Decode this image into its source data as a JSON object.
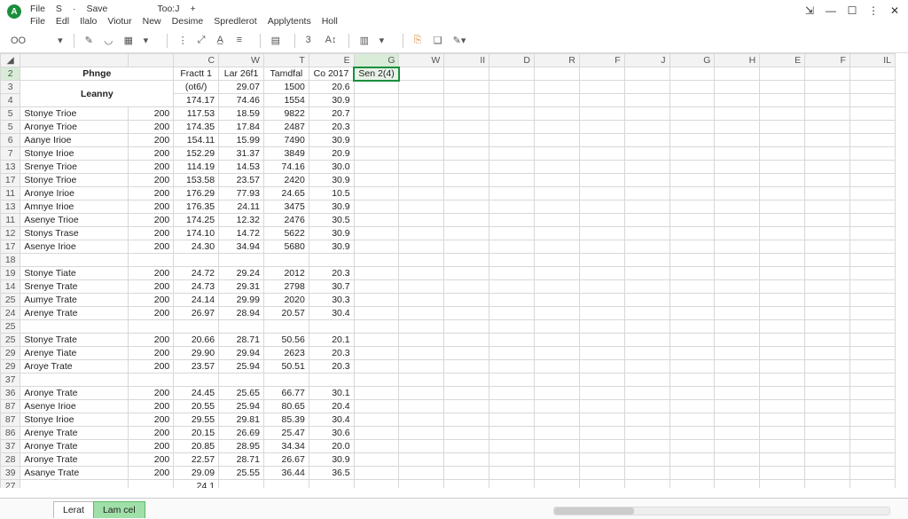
{
  "titlebar": {
    "quick1": "File",
    "quick2": "S",
    "dot": "·",
    "save": "Save",
    "tooj": "Too:J",
    "plus": "+",
    "menu": [
      "File",
      "Edl",
      "Ilalo",
      "Viotur",
      "New",
      "Desime",
      "Spredlerot",
      "Applytents",
      "Holl"
    ]
  },
  "window": {
    "restore_glyph": "⇲",
    "min": "—",
    "max": "☐",
    "close": "✕",
    "menu": "⋮"
  },
  "toolbar": {
    "mode": "OO",
    "chev": "▾",
    "icons": [
      "✎",
      "◡",
      "▦",
      "▾",
      "⋮",
      "⤢",
      "A̲",
      "≡",
      "▤",
      "3",
      "A↕",
      "▥",
      "▾",
      "⎘",
      "❑",
      "✎▾"
    ]
  },
  "columns": [
    "",
    "",
    "C",
    "W",
    "T",
    "E",
    "G",
    "W",
    "II",
    "D",
    "R",
    "F",
    "J",
    "G",
    "H",
    "E",
    "F",
    "IL"
  ],
  "merged": {
    "phnge": "Phnge",
    "leanny": "Leanny"
  },
  "headers_row2": {
    "c": "Fractt 1",
    "w": "Lar 26f1",
    "t": "Tamdfal",
    "e": "Co 2017",
    "g": "Sen 2(4)"
  },
  "headers_row3": {
    "c": "(ot6/)",
    "w": "29.07",
    "t": "1500",
    "e": "20.6"
  },
  "headers_row4": {
    "c": "174.17",
    "w": "74.46",
    "t": "1554",
    "e": "30.9"
  },
  "rows": [
    {
      "n": "5",
      "a": "Stonye Trioe",
      "b": "200",
      "c": "117.53",
      "w": "18.59",
      "t": "9822",
      "e": "20.7"
    },
    {
      "n": "5",
      "a": "Aronye Trioe",
      "b": "200",
      "c": "174.35",
      "w": "17.84",
      "t": "2487",
      "e": "20.3"
    },
    {
      "n": "6",
      "a": "Aanye Irioe",
      "b": "200",
      "c": "154.11",
      "w": "15.99",
      "t": "7490",
      "e": "30.9"
    },
    {
      "n": "7",
      "a": "Stonye Irioe",
      "b": "200",
      "c": "152.29",
      "w": "31.37",
      "t": "3849",
      "e": "20.9"
    },
    {
      "n": "13",
      "a": "Srenye Trioe",
      "b": "200",
      "c": "114.19",
      "w": "14.53",
      "t": "74.16",
      "e": "30.0"
    },
    {
      "n": "17",
      "a": "Stonye Trioe",
      "b": "200",
      "c": "153.58",
      "w": "23.57",
      "t": "2420",
      "e": "30.9"
    },
    {
      "n": "11",
      "a": "Aronye Irioe",
      "b": "200",
      "c": "176.29",
      "w": "77.93",
      "t": "24.65",
      "e": "10.5"
    },
    {
      "n": "13",
      "a": "Amnye Irioe",
      "b": "200",
      "c": "176.35",
      "w": "24.11",
      "t": "3475",
      "e": "30.9"
    },
    {
      "n": "11",
      "a": "Asenye Trioe",
      "b": "200",
      "c": "174.25",
      "w": "12.32",
      "t": "2476",
      "e": "30.5"
    },
    {
      "n": "12",
      "a": "Stonys Trase",
      "b": "200",
      "c": "174.10",
      "w": "14.72",
      "t": "5622",
      "e": "30.9"
    },
    {
      "n": "17",
      "a": "Asenye Irioe",
      "b": "200",
      "c": "24.30",
      "w": "34.94",
      "t": "5680",
      "e": "30.9"
    },
    {
      "n": "18",
      "a": "",
      "b": "",
      "c": "",
      "w": "",
      "t": "",
      "e": ""
    },
    {
      "n": "19",
      "a": "Stonye Tiate",
      "b": "200",
      "c": "24.72",
      "w": "29.24",
      "t": "2012",
      "e": "20.3"
    },
    {
      "n": "14",
      "a": "Srenye Trate",
      "b": "200",
      "c": "24.73",
      "w": "29.31",
      "t": "2798",
      "e": "30.7"
    },
    {
      "n": "25",
      "a": "Aumye Trate",
      "b": "200",
      "c": "24.14",
      "w": "29.99",
      "t": "2020",
      "e": "30.3"
    },
    {
      "n": "24",
      "a": "Arenye Trate",
      "b": "200",
      "c": "26.97",
      "w": "28.94",
      "t": "20.57",
      "e": "30.4"
    },
    {
      "n": "25",
      "a": "",
      "b": "",
      "c": "",
      "w": "",
      "t": "",
      "e": ""
    },
    {
      "n": "25",
      "a": "Stonye Trate",
      "b": "200",
      "c": "20.66",
      "w": "28.71",
      "t": "50.56",
      "e": "20.1"
    },
    {
      "n": "29",
      "a": "Arenye Tiate",
      "b": "200",
      "c": "29.90",
      "w": "29.94",
      "t": "2623",
      "e": "20.3"
    },
    {
      "n": "29",
      "a": "Aroye Trate",
      "b": "200",
      "c": "23.57",
      "w": "25.94",
      "t": "50.51",
      "e": "20.3"
    },
    {
      "n": "37",
      "a": "",
      "b": "",
      "c": "",
      "w": "",
      "t": "",
      "e": ""
    },
    {
      "n": "36",
      "a": "Aronye Trate",
      "b": "200",
      "c": "24.45",
      "w": "25.65",
      "t": "66.77",
      "e": "30.1"
    },
    {
      "n": "87",
      "a": "Asenye Irioe",
      "b": "200",
      "c": "20.55",
      "w": "25.94",
      "t": "80.65",
      "e": "20.4"
    },
    {
      "n": "87",
      "a": "Stonye Irioe",
      "b": "200",
      "c": "29.55",
      "w": "29.81",
      "t": "85.39",
      "e": "30.4"
    },
    {
      "n": "86",
      "a": "Arenye Trate",
      "b": "200",
      "c": "20.15",
      "w": "26.69",
      "t": "25.47",
      "e": "30.6"
    },
    {
      "n": "37",
      "a": "Aronye Trate",
      "b": "200",
      "c": "20.85",
      "w": "28.95",
      "t": "34.34",
      "e": "20.0"
    },
    {
      "n": "28",
      "a": "Aronye Trate",
      "b": "200",
      "c": "22.57",
      "w": "28.71",
      "t": "26.67",
      "e": "30.9"
    },
    {
      "n": "39",
      "a": "Asanye Trate",
      "b": "200",
      "c": "29.09",
      "w": "25.55",
      "t": "36.44",
      "e": "36.5"
    },
    {
      "n": "27",
      "a": "",
      "b": "",
      "c": "24.1",
      "w": "",
      "t": "",
      "e": ""
    }
  ],
  "tabs": {
    "t1": "Lerat",
    "t2": "Lam cel"
  }
}
